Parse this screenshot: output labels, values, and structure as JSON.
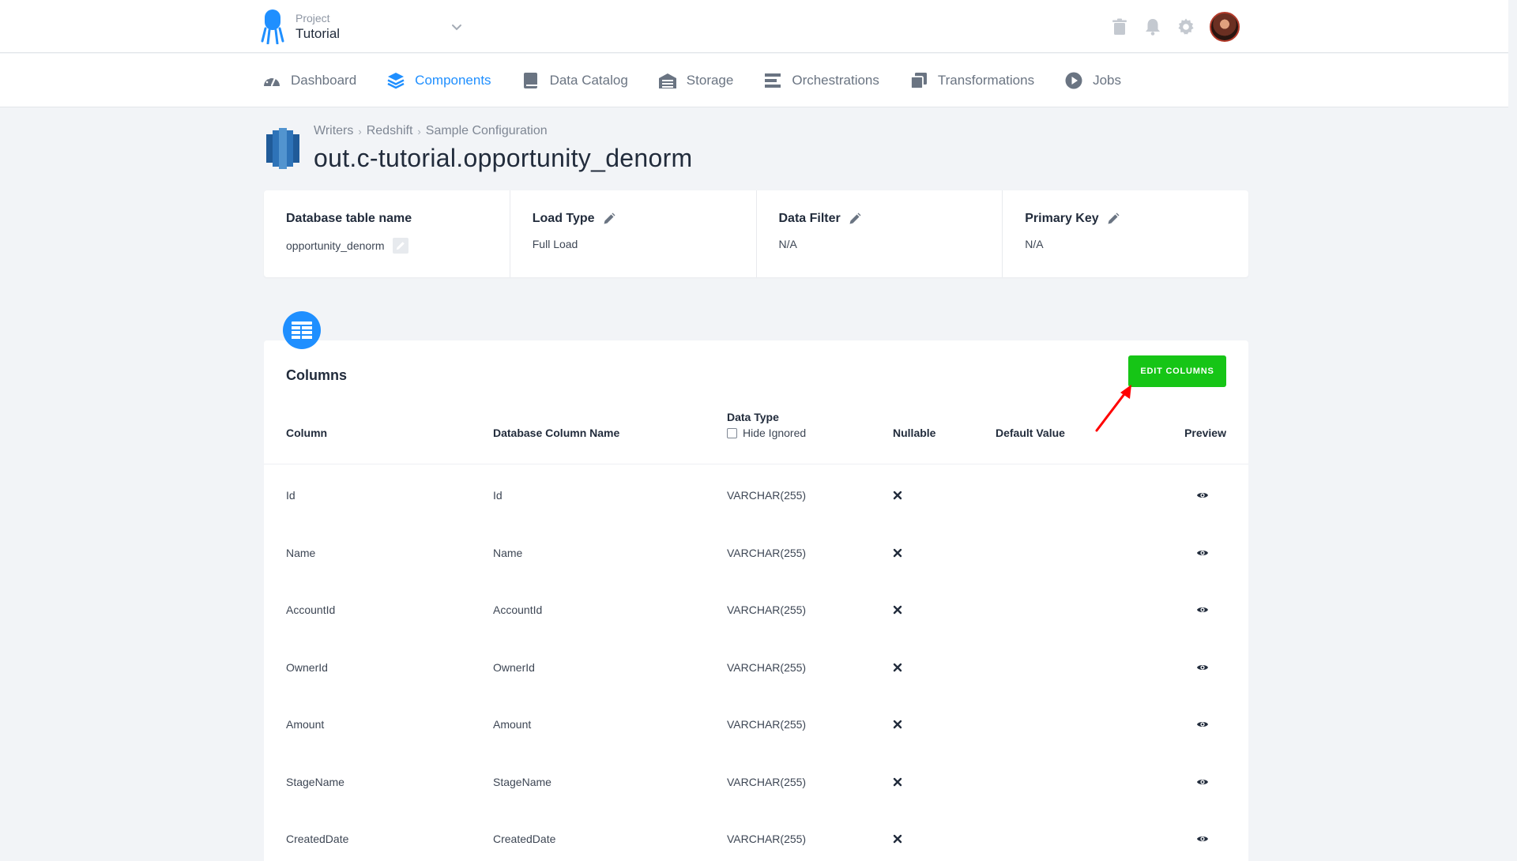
{
  "project": {
    "caption": "Project",
    "name": "Tutorial"
  },
  "icons": {
    "trash": "trash-icon",
    "bell": "bell-icon",
    "gear": "gear-icon",
    "close": "x-icon",
    "preview": "eye-icon",
    "edit": "pencil-icon"
  },
  "colors": {
    "accent": "#1f8fff",
    "success": "#16c516",
    "annotation": "#ff0000"
  },
  "nav": [
    {
      "label": "Dashboard",
      "icon": "gauge-icon"
    },
    {
      "label": "Components",
      "icon": "layers-icon",
      "active": true
    },
    {
      "label": "Data Catalog",
      "icon": "book-icon"
    },
    {
      "label": "Storage",
      "icon": "warehouse-icon"
    },
    {
      "label": "Orchestrations",
      "icon": "list-icon"
    },
    {
      "label": "Transformations",
      "icon": "copy-icon"
    },
    {
      "label": "Jobs",
      "icon": "play-circle-icon"
    }
  ],
  "breadcrumb": [
    "Writers",
    "Redshift",
    "Sample Configuration"
  ],
  "page_title": "out.c-tutorial.opportunity_denorm",
  "info": {
    "table_name_label": "Database table name",
    "table_name_value": "opportunity_denorm",
    "load_type_label": "Load Type",
    "load_type_value": "Full Load",
    "data_filter_label": "Data Filter",
    "data_filter_value": "N/A",
    "primary_key_label": "Primary Key",
    "primary_key_value": "N/A"
  },
  "columns_section": {
    "title": "Columns",
    "edit_button": "EDIT COLUMNS",
    "headers": {
      "column": "Column",
      "db_column": "Database Column Name",
      "data_type": "Data Type",
      "hide_ignored": "Hide Ignored",
      "nullable": "Nullable",
      "default_value": "Default Value",
      "preview": "Preview"
    },
    "rows": [
      {
        "column": "Id",
        "db_column": "Id",
        "data_type": "VARCHAR(255)",
        "default_value": ""
      },
      {
        "column": "Name",
        "db_column": "Name",
        "data_type": "VARCHAR(255)",
        "default_value": ""
      },
      {
        "column": "AccountId",
        "db_column": "AccountId",
        "data_type": "VARCHAR(255)",
        "default_value": ""
      },
      {
        "column": "OwnerId",
        "db_column": "OwnerId",
        "data_type": "VARCHAR(255)",
        "default_value": ""
      },
      {
        "column": "Amount",
        "db_column": "Amount",
        "data_type": "VARCHAR(255)",
        "default_value": ""
      },
      {
        "column": "StageName",
        "db_column": "StageName",
        "data_type": "VARCHAR(255)",
        "default_value": ""
      },
      {
        "column": "CreatedDate",
        "db_column": "CreatedDate",
        "data_type": "VARCHAR(255)",
        "default_value": ""
      }
    ]
  }
}
